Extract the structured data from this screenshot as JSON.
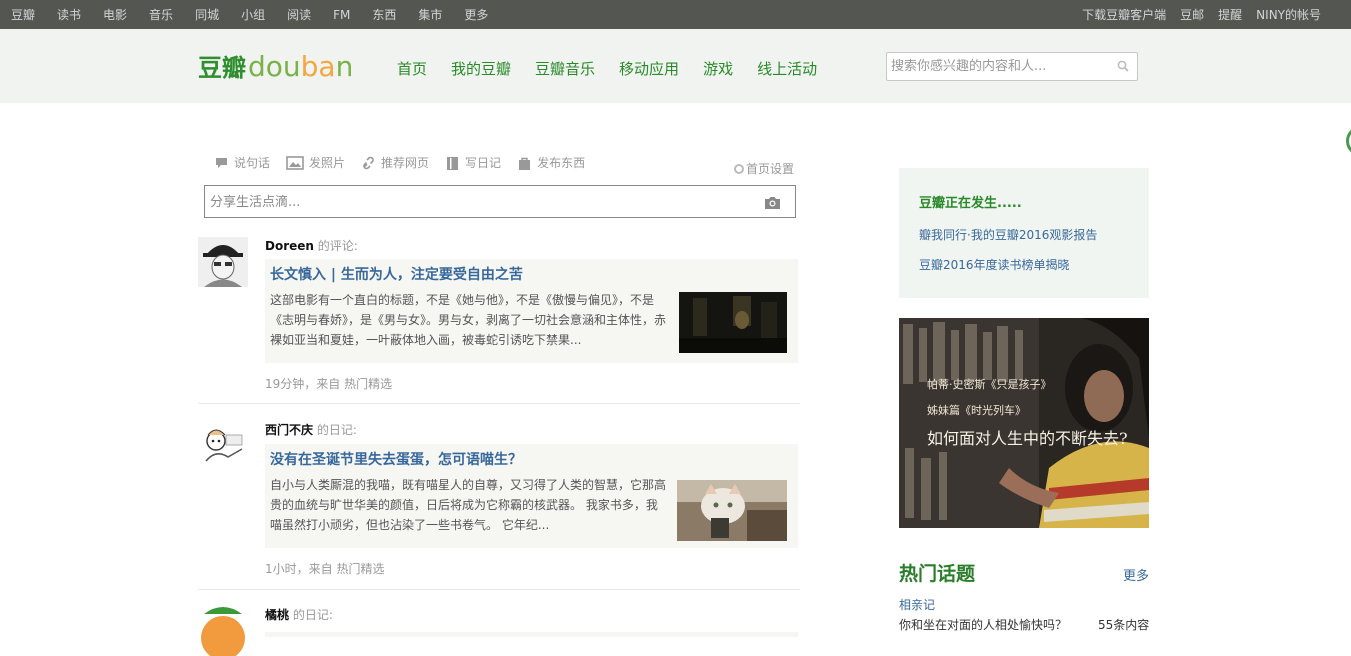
{
  "topnav": {
    "left": [
      "豆瓣",
      "读书",
      "电影",
      "音乐",
      "同城",
      "小组",
      "阅读",
      "FM",
      "东西",
      "集市",
      "更多"
    ],
    "right": [
      "下载豆瓣客户端",
      "豆邮",
      "提醒",
      "NINY的帐号"
    ]
  },
  "header": {
    "logo_cn": "豆瓣",
    "logo_en_a": "dou",
    "logo_en_b": "ba",
    "logo_en_c": "n",
    "nav": [
      "首页",
      "我的豆瓣",
      "豆瓣音乐",
      "移动应用",
      "游戏",
      "线上活动"
    ],
    "search_placeholder": "搜索你感兴趣的内容和人..."
  },
  "share": {
    "items": [
      {
        "label": "说句话",
        "icon": "speech-bubble-icon"
      },
      {
        "label": "发照片",
        "icon": "photo-icon"
      },
      {
        "label": "推荐网页",
        "icon": "link-icon"
      },
      {
        "label": "写日记",
        "icon": "book-icon"
      },
      {
        "label": "发布东西",
        "icon": "bag-icon"
      }
    ],
    "home_settings": "首页设置",
    "placeholder": "分享生活点滴..."
  },
  "feed": [
    {
      "user": "Doreen",
      "action": "的评论:",
      "title": "长文慎入 | 生而为人，注定要受自由之苦",
      "body": "这部电影有一个直白的标题，不是《她与他》，不是《傲慢与偏见》，不是《志明与春娇》，是《男与女》。男与女，剥离了一切社会意涵和主体性，赤裸如亚当和夏娃，一叶蔽体地入画，被毒蛇引诱吃下禁果...",
      "meta": "19分钟，来自 热门精选"
    },
    {
      "user": "西门不庆",
      "action": "的日记:",
      "title": "没有在圣诞节里失去蛋蛋，怎可语喵生？",
      "body": "自小与人类厮混的我喵，既有喵星人的自尊，又习得了人类的智慧，它那高贵的血统与旷世华美的颜值，日后将成为它称霸的核武器。 我家书多，我喵虽然打小顽劣，但也沾染了一些书卷气。 它年纪...",
      "meta": "1小时，来自 热门精选"
    },
    {
      "user": "橘桃",
      "action": "的日记:"
    }
  ],
  "sidebar": {
    "happening_title": "豆瓣正在发生.....",
    "happening_links": [
      "瓣我同行·我的豆瓣2016观影报告",
      "豆瓣2016年度读书榜单揭晓"
    ],
    "ad_line1": "帕蒂·史密斯《只是孩子》",
    "ad_line2": "姊妹篇《时光列车》",
    "ad_line3": "如何面对人生中的不断失去?",
    "hot_title": "热门话题",
    "hot_more": "更多",
    "hot_topic": "相亲记",
    "hot_desc": "你和坐在对面的人相处愉快吗？",
    "hot_count": "55条内容"
  },
  "colors": {
    "topnav_bg": "#545652",
    "header_bg": "#f0f3ef",
    "brand_green": "#2a8a2a",
    "link_blue": "#38689b"
  }
}
